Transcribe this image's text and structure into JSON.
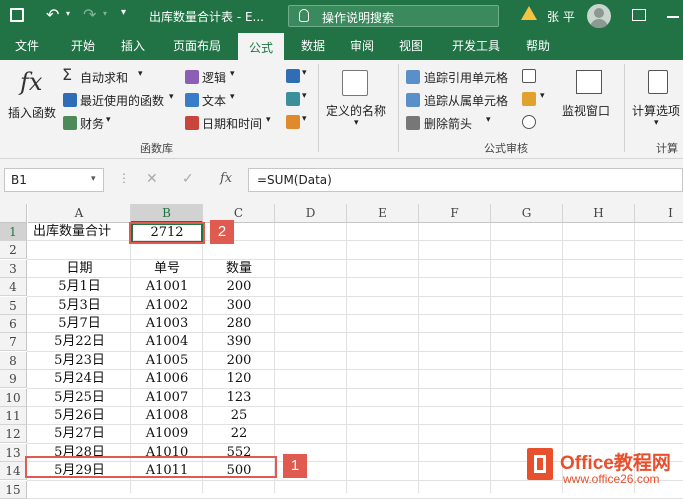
{
  "window": {
    "title": "出库数量合计表 - E...",
    "tell_me": "操作说明搜索",
    "user": "张 平"
  },
  "tabs": [
    "文件",
    "开始",
    "插入",
    "页面布局",
    "公式",
    "数据",
    "审阅",
    "视图",
    "开发工具",
    "帮助"
  ],
  "active_tab": "公式",
  "ribbon": {
    "insert_function": "插入函数",
    "autosum": "自动求和",
    "recent": "最近使用的函数",
    "financial": "财务",
    "logical": "逻辑",
    "text": "文本",
    "datetime": "日期和时间",
    "group_library": "函数库",
    "defined_names": "定义的名称",
    "trace_precedents": "追踪引用单元格",
    "trace_dependents": "追踪从属单元格",
    "remove_arrows": "删除箭头",
    "group_audit": "公式审核",
    "watch_window": "监视窗口",
    "calc_options": "计算选项",
    "group_calc": "计算"
  },
  "formula_bar": {
    "name_box": "B1",
    "fx": "fx",
    "formula": "=SUM(Data)"
  },
  "columns": [
    "A",
    "B",
    "C",
    "D",
    "E",
    "F",
    "G",
    "H",
    "I"
  ],
  "rows": [
    "1",
    "2",
    "3",
    "4",
    "5",
    "6",
    "7",
    "8",
    "9",
    "10",
    "11",
    "12",
    "13",
    "14",
    "15"
  ],
  "sheet": {
    "a1": "出库数量合计",
    "b1": "2712",
    "headers": [
      "日期",
      "单号",
      "数量"
    ],
    "data": [
      [
        "5月1日",
        "A1001",
        "200"
      ],
      [
        "5月3日",
        "A1002",
        "300"
      ],
      [
        "5月7日",
        "A1003",
        "280"
      ],
      [
        "5月22日",
        "A1004",
        "390"
      ],
      [
        "5月23日",
        "A1005",
        "200"
      ],
      [
        "5月24日",
        "A1006",
        "120"
      ],
      [
        "5月25日",
        "A1007",
        "123"
      ],
      [
        "5月26日",
        "A1008",
        "25"
      ],
      [
        "5月27日",
        "A1009",
        "22"
      ],
      [
        "5月28日",
        "A1010",
        "552"
      ],
      [
        "5月29日",
        "A1011",
        "500"
      ]
    ]
  },
  "callouts": [
    "1",
    "2"
  ],
  "watermark": {
    "brand": "Office教程网",
    "url": "www.office26.com"
  },
  "colors": {
    "excel_green": "#217346",
    "callout_red": "#e05a4f"
  }
}
